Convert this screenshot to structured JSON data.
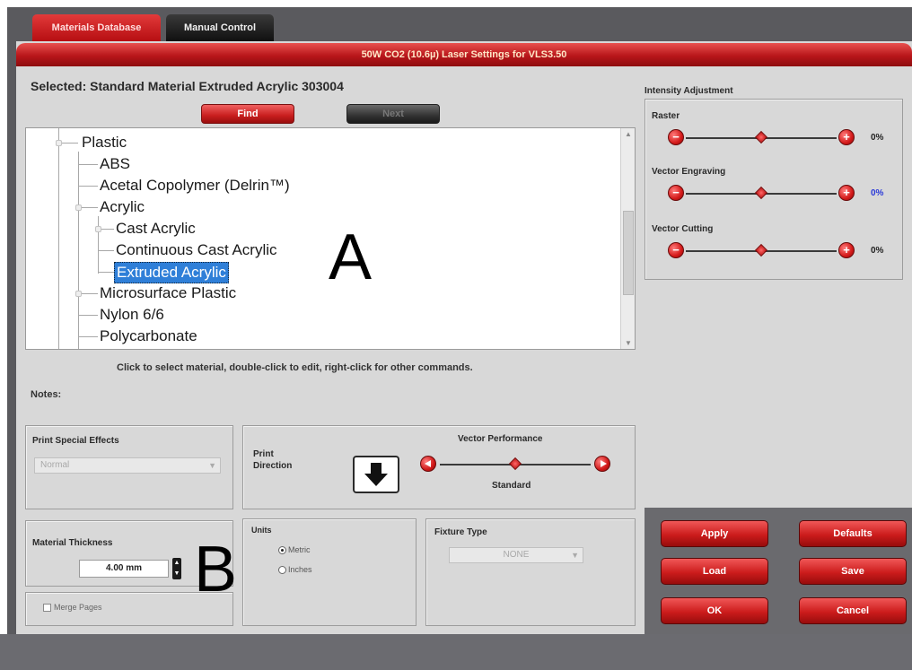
{
  "tabs": [
    {
      "label": "Materials Database",
      "active": true
    },
    {
      "label": "Manual Control",
      "active": false
    }
  ],
  "title": "50W CO2 (10.6µ) Laser Settings for VLS3.50",
  "selected_label": "Selected: Standard Material Extruded Acrylic 303004",
  "find_button": "Find",
  "disabled_button": "Next",
  "tree": {
    "items": [
      {
        "label": "Plastic"
      },
      {
        "label": "ABS"
      },
      {
        "label": "Acetal Copolymer (Delrin™)"
      },
      {
        "label": "Acrylic"
      },
      {
        "label": "Cast Acrylic"
      },
      {
        "label": "Continuous Cast Acrylic"
      },
      {
        "label": "Extruded Acrylic",
        "selected": true
      },
      {
        "label": "Microsurface Plastic"
      },
      {
        "label": "Nylon 6/6"
      },
      {
        "label": "Polycarbonate"
      }
    ]
  },
  "annotations": {
    "a": "A",
    "b": "B"
  },
  "hint": "Click to select material, double-click to edit, right-click for other commands.",
  "notes_label": "Notes:",
  "intensity": {
    "title": "Intensity Adjustment",
    "rows": [
      {
        "label": "Raster",
        "value": "0%",
        "level": 0.5
      },
      {
        "label": "Vector Engraving",
        "value": "0%",
        "level": 0.5
      },
      {
        "label": "Vector Cutting",
        "value": "0%",
        "level": 0.5
      }
    ],
    "minus": "−",
    "plus": "+"
  },
  "print_effects": {
    "title": "Print Special Effects",
    "value": "Normal"
  },
  "print_direction": {
    "title": "Print Direction",
    "icon": "down-arrow-icon"
  },
  "vector_performance": {
    "title": "Vector Performance",
    "value": "Standard",
    "level": 0.5
  },
  "material_thickness": {
    "title": "Material Thickness",
    "value": "4.00 mm"
  },
  "units": {
    "title": "Units",
    "options": [
      {
        "label": "Metric",
        "checked": true
      },
      {
        "label": "Inches",
        "checked": false
      }
    ]
  },
  "fixture": {
    "title": "Fixture Type",
    "value": "NONE"
  },
  "merge_pages": "Merge Pages",
  "actions": {
    "apply": "Apply",
    "defaults": "Defaults",
    "load": "Load",
    "save": "Save",
    "ok": "OK",
    "cancel": "Cancel"
  },
  "colors": {
    "accent_red": "#c81e1e",
    "panel_gray": "#d8d8d8",
    "selection_blue": "#2f7fd8",
    "blue_pct": "#2a3ad8"
  }
}
